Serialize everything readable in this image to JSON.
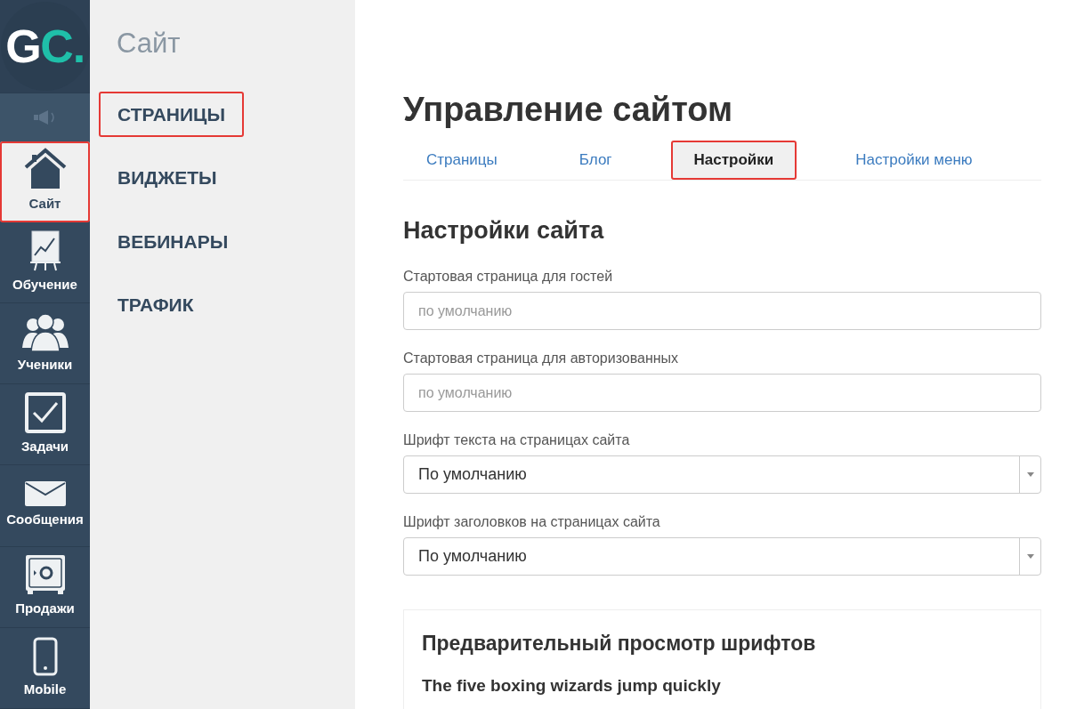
{
  "logo": {
    "text": "GC",
    "dot": "."
  },
  "rail": [
    {
      "kind": "site",
      "label": "Сайт",
      "selected": true,
      "highlighted": true
    },
    {
      "kind": "learning",
      "label": "Обучение",
      "selected": false,
      "highlighted": false
    },
    {
      "kind": "students",
      "label": "Ученики",
      "selected": false,
      "highlighted": false
    },
    {
      "kind": "tasks",
      "label": "Задачи",
      "selected": false,
      "highlighted": false
    },
    {
      "kind": "messages",
      "label": "Сообщения",
      "selected": false,
      "highlighted": false
    },
    {
      "kind": "sales",
      "label": "Продажи",
      "selected": false,
      "highlighted": false
    },
    {
      "kind": "mobile",
      "label": "Mobile",
      "selected": false,
      "highlighted": false
    }
  ],
  "submenu": {
    "title": "Сайт",
    "items": [
      {
        "label": "СТРАНИЦЫ",
        "highlighted": true
      },
      {
        "label": "ВИДЖЕТЫ",
        "highlighted": false
      },
      {
        "label": "ВЕБИНАРЫ",
        "highlighted": false
      },
      {
        "label": "ТРАФИК",
        "highlighted": false
      }
    ]
  },
  "page_title": "Управление сайтом",
  "tabs": [
    {
      "label": "Страницы",
      "selected": false,
      "highlighted": false
    },
    {
      "label": "Блог",
      "selected": false,
      "highlighted": false
    },
    {
      "label": "Настройки",
      "selected": true,
      "highlighted": true
    },
    {
      "label": "Настройки меню",
      "selected": false,
      "highlighted": false
    }
  ],
  "section_title": "Настройки сайта",
  "fields": [
    {
      "kind": "input",
      "label": "Стартовая страница для гостей",
      "placeholder": "по умолчанию"
    },
    {
      "kind": "input",
      "label": "Стартовая страница для авторизованных",
      "placeholder": "по умолчанию"
    },
    {
      "kind": "select",
      "label": "Шрифт текста на страницах сайта",
      "value": "По умолчанию"
    },
    {
      "kind": "select",
      "label": "Шрифт заголовков на страницах сайта",
      "value": "По умолчанию"
    }
  ],
  "preview": {
    "title": "Предварительный просмотр шрифтов",
    "sample": "The five boxing wizards jump quickly"
  }
}
